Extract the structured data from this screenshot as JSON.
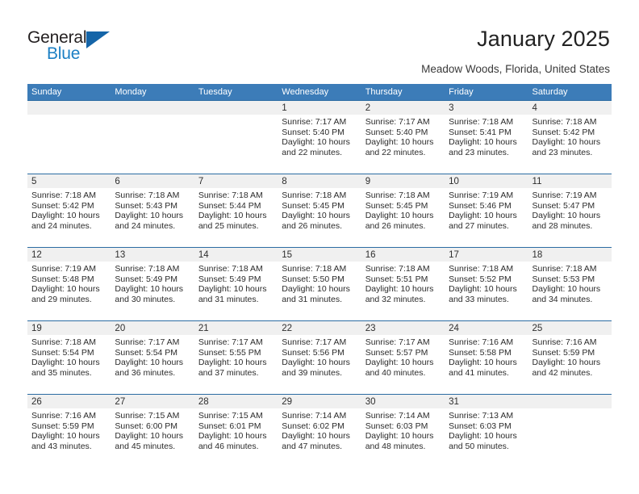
{
  "branding": {
    "logo_primary": "General",
    "logo_secondary": "Blue",
    "logo_icon": "triangle-logo-mark",
    "primary_color": "#1b7fc4",
    "header_color": "#3c7cb8"
  },
  "header": {
    "title": "January 2025",
    "subtitle": "Meadow Woods, Florida, United States"
  },
  "calendar": {
    "weekday_headers": [
      "Sunday",
      "Monday",
      "Tuesday",
      "Wednesday",
      "Thursday",
      "Friday",
      "Saturday"
    ],
    "weeks": [
      [
        {
          "day": "",
          "sunrise": "",
          "sunset": "",
          "daylight_line1": "",
          "daylight_line2": ""
        },
        {
          "day": "",
          "sunrise": "",
          "sunset": "",
          "daylight_line1": "",
          "daylight_line2": ""
        },
        {
          "day": "",
          "sunrise": "",
          "sunset": "",
          "daylight_line1": "",
          "daylight_line2": ""
        },
        {
          "day": "1",
          "sunrise": "Sunrise: 7:17 AM",
          "sunset": "Sunset: 5:40 PM",
          "daylight_line1": "Daylight: 10 hours",
          "daylight_line2": "and 22 minutes."
        },
        {
          "day": "2",
          "sunrise": "Sunrise: 7:17 AM",
          "sunset": "Sunset: 5:40 PM",
          "daylight_line1": "Daylight: 10 hours",
          "daylight_line2": "and 22 minutes."
        },
        {
          "day": "3",
          "sunrise": "Sunrise: 7:18 AM",
          "sunset": "Sunset: 5:41 PM",
          "daylight_line1": "Daylight: 10 hours",
          "daylight_line2": "and 23 minutes."
        },
        {
          "day": "4",
          "sunrise": "Sunrise: 7:18 AM",
          "sunset": "Sunset: 5:42 PM",
          "daylight_line1": "Daylight: 10 hours",
          "daylight_line2": "and 23 minutes."
        }
      ],
      [
        {
          "day": "5",
          "sunrise": "Sunrise: 7:18 AM",
          "sunset": "Sunset: 5:42 PM",
          "daylight_line1": "Daylight: 10 hours",
          "daylight_line2": "and 24 minutes."
        },
        {
          "day": "6",
          "sunrise": "Sunrise: 7:18 AM",
          "sunset": "Sunset: 5:43 PM",
          "daylight_line1": "Daylight: 10 hours",
          "daylight_line2": "and 24 minutes."
        },
        {
          "day": "7",
          "sunrise": "Sunrise: 7:18 AM",
          "sunset": "Sunset: 5:44 PM",
          "daylight_line1": "Daylight: 10 hours",
          "daylight_line2": "and 25 minutes."
        },
        {
          "day": "8",
          "sunrise": "Sunrise: 7:18 AM",
          "sunset": "Sunset: 5:45 PM",
          "daylight_line1": "Daylight: 10 hours",
          "daylight_line2": "and 26 minutes."
        },
        {
          "day": "9",
          "sunrise": "Sunrise: 7:18 AM",
          "sunset": "Sunset: 5:45 PM",
          "daylight_line1": "Daylight: 10 hours",
          "daylight_line2": "and 26 minutes."
        },
        {
          "day": "10",
          "sunrise": "Sunrise: 7:19 AM",
          "sunset": "Sunset: 5:46 PM",
          "daylight_line1": "Daylight: 10 hours",
          "daylight_line2": "and 27 minutes."
        },
        {
          "day": "11",
          "sunrise": "Sunrise: 7:19 AM",
          "sunset": "Sunset: 5:47 PM",
          "daylight_line1": "Daylight: 10 hours",
          "daylight_line2": "and 28 minutes."
        }
      ],
      [
        {
          "day": "12",
          "sunrise": "Sunrise: 7:19 AM",
          "sunset": "Sunset: 5:48 PM",
          "daylight_line1": "Daylight: 10 hours",
          "daylight_line2": "and 29 minutes."
        },
        {
          "day": "13",
          "sunrise": "Sunrise: 7:18 AM",
          "sunset": "Sunset: 5:49 PM",
          "daylight_line1": "Daylight: 10 hours",
          "daylight_line2": "and 30 minutes."
        },
        {
          "day": "14",
          "sunrise": "Sunrise: 7:18 AM",
          "sunset": "Sunset: 5:49 PM",
          "daylight_line1": "Daylight: 10 hours",
          "daylight_line2": "and 31 minutes."
        },
        {
          "day": "15",
          "sunrise": "Sunrise: 7:18 AM",
          "sunset": "Sunset: 5:50 PM",
          "daylight_line1": "Daylight: 10 hours",
          "daylight_line2": "and 31 minutes."
        },
        {
          "day": "16",
          "sunrise": "Sunrise: 7:18 AM",
          "sunset": "Sunset: 5:51 PM",
          "daylight_line1": "Daylight: 10 hours",
          "daylight_line2": "and 32 minutes."
        },
        {
          "day": "17",
          "sunrise": "Sunrise: 7:18 AM",
          "sunset": "Sunset: 5:52 PM",
          "daylight_line1": "Daylight: 10 hours",
          "daylight_line2": "and 33 minutes."
        },
        {
          "day": "18",
          "sunrise": "Sunrise: 7:18 AM",
          "sunset": "Sunset: 5:53 PM",
          "daylight_line1": "Daylight: 10 hours",
          "daylight_line2": "and 34 minutes."
        }
      ],
      [
        {
          "day": "19",
          "sunrise": "Sunrise: 7:18 AM",
          "sunset": "Sunset: 5:54 PM",
          "daylight_line1": "Daylight: 10 hours",
          "daylight_line2": "and 35 minutes."
        },
        {
          "day": "20",
          "sunrise": "Sunrise: 7:17 AM",
          "sunset": "Sunset: 5:54 PM",
          "daylight_line1": "Daylight: 10 hours",
          "daylight_line2": "and 36 minutes."
        },
        {
          "day": "21",
          "sunrise": "Sunrise: 7:17 AM",
          "sunset": "Sunset: 5:55 PM",
          "daylight_line1": "Daylight: 10 hours",
          "daylight_line2": "and 37 minutes."
        },
        {
          "day": "22",
          "sunrise": "Sunrise: 7:17 AM",
          "sunset": "Sunset: 5:56 PM",
          "daylight_line1": "Daylight: 10 hours",
          "daylight_line2": "and 39 minutes."
        },
        {
          "day": "23",
          "sunrise": "Sunrise: 7:17 AM",
          "sunset": "Sunset: 5:57 PM",
          "daylight_line1": "Daylight: 10 hours",
          "daylight_line2": "and 40 minutes."
        },
        {
          "day": "24",
          "sunrise": "Sunrise: 7:16 AM",
          "sunset": "Sunset: 5:58 PM",
          "daylight_line1": "Daylight: 10 hours",
          "daylight_line2": "and 41 minutes."
        },
        {
          "day": "25",
          "sunrise": "Sunrise: 7:16 AM",
          "sunset": "Sunset: 5:59 PM",
          "daylight_line1": "Daylight: 10 hours",
          "daylight_line2": "and 42 minutes."
        }
      ],
      [
        {
          "day": "26",
          "sunrise": "Sunrise: 7:16 AM",
          "sunset": "Sunset: 5:59 PM",
          "daylight_line1": "Daylight: 10 hours",
          "daylight_line2": "and 43 minutes."
        },
        {
          "day": "27",
          "sunrise": "Sunrise: 7:15 AM",
          "sunset": "Sunset: 6:00 PM",
          "daylight_line1": "Daylight: 10 hours",
          "daylight_line2": "and 45 minutes."
        },
        {
          "day": "28",
          "sunrise": "Sunrise: 7:15 AM",
          "sunset": "Sunset: 6:01 PM",
          "daylight_line1": "Daylight: 10 hours",
          "daylight_line2": "and 46 minutes."
        },
        {
          "day": "29",
          "sunrise": "Sunrise: 7:14 AM",
          "sunset": "Sunset: 6:02 PM",
          "daylight_line1": "Daylight: 10 hours",
          "daylight_line2": "and 47 minutes."
        },
        {
          "day": "30",
          "sunrise": "Sunrise: 7:14 AM",
          "sunset": "Sunset: 6:03 PM",
          "daylight_line1": "Daylight: 10 hours",
          "daylight_line2": "and 48 minutes."
        },
        {
          "day": "31",
          "sunrise": "Sunrise: 7:13 AM",
          "sunset": "Sunset: 6:03 PM",
          "daylight_line1": "Daylight: 10 hours",
          "daylight_line2": "and 50 minutes."
        },
        {
          "day": "",
          "sunrise": "",
          "sunset": "",
          "daylight_line1": "",
          "daylight_line2": ""
        }
      ]
    ]
  }
}
